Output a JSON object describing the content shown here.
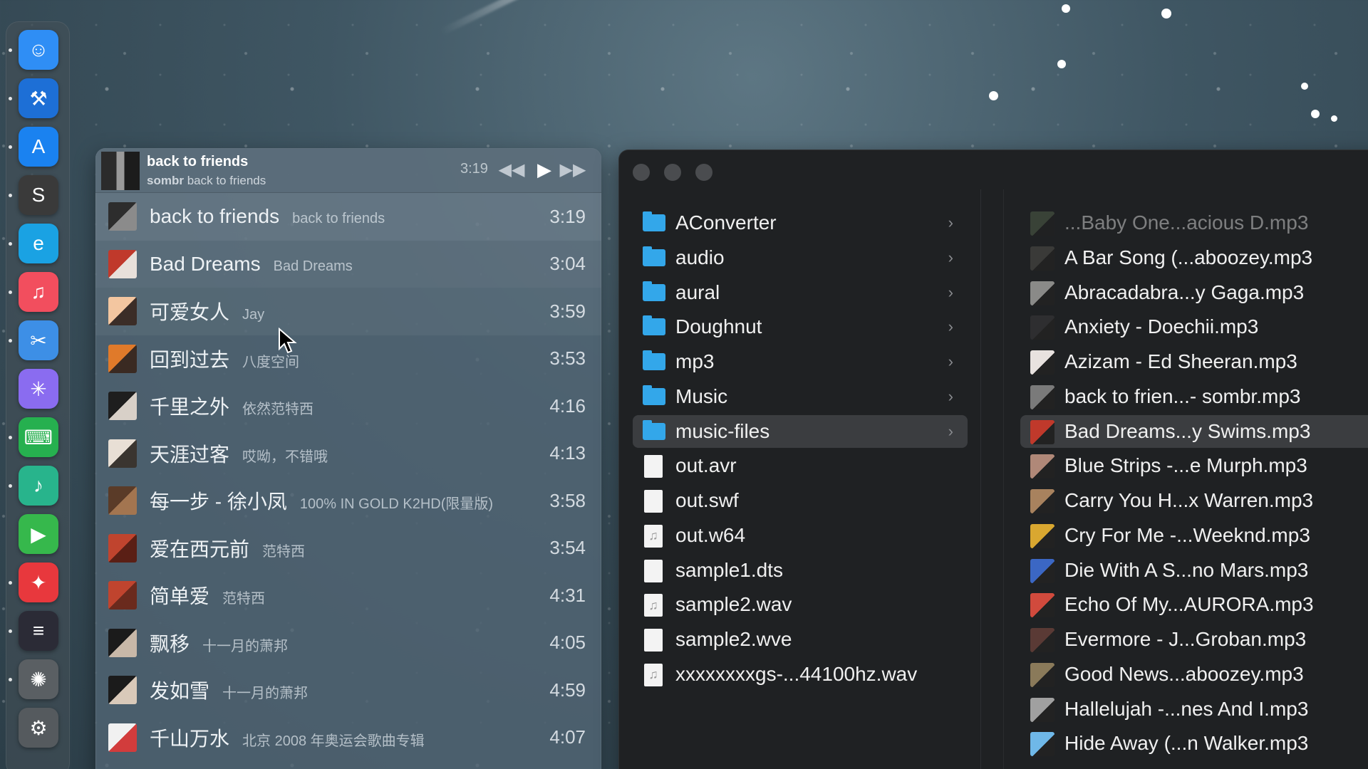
{
  "dock": {
    "items": [
      {
        "name": "finder-icon",
        "glyph": "☺",
        "color": "#2f8ef5",
        "running": true
      },
      {
        "name": "xcode-icon",
        "glyph": "⚒",
        "color": "#1d6fd6",
        "running": true
      },
      {
        "name": "app-store-icon",
        "glyph": "A",
        "color": "#1a82f0",
        "running": true
      },
      {
        "name": "sublime-text-icon",
        "glyph": "S",
        "color": "#3a3a3a",
        "running": true
      },
      {
        "name": "edge-browser-icon",
        "glyph": "e",
        "color": "#1aa2e3",
        "running": true
      },
      {
        "name": "music-app-icon",
        "glyph": "♫",
        "color": "#f24e5e",
        "running": true
      },
      {
        "name": "developer-tools-icon",
        "glyph": "✂",
        "color": "#3d8fe6",
        "running": true
      },
      {
        "name": "launchpad-icon",
        "glyph": "✳",
        "color": "#8a6cf0",
        "running": false
      },
      {
        "name": "keyboard-app-icon",
        "glyph": "⌨",
        "color": "#26b04f",
        "running": true
      },
      {
        "name": "music-note-app-icon",
        "glyph": "♪",
        "color": "#28b48c",
        "running": true
      },
      {
        "name": "infuse-player-icon",
        "glyph": "▶",
        "color": "#36b84c",
        "running": false
      },
      {
        "name": "photo-booth-icon",
        "glyph": "✦",
        "color": "#e8383d",
        "running": true
      },
      {
        "name": "terminal-icon",
        "glyph": "≡",
        "color": "#2b2b36",
        "running": true
      },
      {
        "name": "chatgpt-icon",
        "glyph": "✺",
        "color": "#5a5f63",
        "running": true
      },
      {
        "name": "system-settings-icon",
        "glyph": "⚙",
        "color": "#555a5e",
        "running": false
      }
    ]
  },
  "player": {
    "now_playing": {
      "title": "back to friends",
      "artist": "sombr",
      "album": "back to friends",
      "time": "3:19"
    },
    "tracks": [
      {
        "title": "back to friends",
        "artist": "back to friends",
        "duration": "3:19",
        "art": [
          "#2d2d2d",
          "#8b8b8b"
        ]
      },
      {
        "title": "Bad Dreams",
        "artist": "Bad Dreams",
        "duration": "3:04",
        "art": [
          "#c0392b",
          "#e8e0da"
        ]
      },
      {
        "title": "可爱女人",
        "artist": "Jay",
        "duration": "3:59",
        "art": [
          "#f3c6a0",
          "#3b2d27"
        ]
      },
      {
        "title": "回到过去",
        "artist": "八度空间",
        "duration": "3:53",
        "art": [
          "#e07a2a",
          "#3a2a22"
        ]
      },
      {
        "title": "千里之外",
        "artist": "依然范特西",
        "duration": "4:16",
        "art": [
          "#1e1e1e",
          "#d8d0c8"
        ]
      },
      {
        "title": "天涯过客",
        "artist": "哎呦，不错哦",
        "duration": "4:13",
        "art": [
          "#e8dfd5",
          "#3a3530"
        ]
      },
      {
        "title": "每一步 - 徐小凤",
        "artist": "100% IN GOLD K2HD(限量版)",
        "duration": "3:58",
        "art": [
          "#5a3b28",
          "#a37550"
        ]
      },
      {
        "title": "爱在西元前",
        "artist": "范特西",
        "duration": "3:54",
        "art": [
          "#c0442e",
          "#5a1f15"
        ]
      },
      {
        "title": "简单爱",
        "artist": "范特西",
        "duration": "4:31",
        "art": [
          "#c0442e",
          "#6a2a1d"
        ]
      },
      {
        "title": "飘移",
        "artist": "十一月的萧邦",
        "duration": "4:05",
        "art": [
          "#1b1b1b",
          "#c8b8a8"
        ]
      },
      {
        "title": "发如雪",
        "artist": "十一月的萧邦",
        "duration": "4:59",
        "art": [
          "#1b1b1b",
          "#d9c9b9"
        ]
      },
      {
        "title": "千山万水",
        "artist": "北京 2008 年奥运会歌曲专辑",
        "duration": "4:07",
        "art": [
          "#f1f1f1",
          "#d23c3c"
        ]
      }
    ]
  },
  "finder": {
    "column1": [
      {
        "kind": "folder",
        "name": "AConverter",
        "chevron": "›"
      },
      {
        "kind": "folder",
        "name": "audio",
        "chevron": "›"
      },
      {
        "kind": "folder",
        "name": "aural",
        "chevron": "›"
      },
      {
        "kind": "folder",
        "name": "Doughnut",
        "chevron": "›"
      },
      {
        "kind": "folder",
        "name": "mp3",
        "chevron": "›"
      },
      {
        "kind": "folder",
        "name": "Music",
        "chevron": "›"
      },
      {
        "kind": "folder",
        "name": "music-files",
        "chevron": "›",
        "selected": true
      },
      {
        "kind": "file",
        "name": "out.avr"
      },
      {
        "kind": "file",
        "name": "out.swf"
      },
      {
        "kind": "audio",
        "name": "out.w64"
      },
      {
        "kind": "file",
        "name": "sample1.dts"
      },
      {
        "kind": "audio",
        "name": "sample2.wav"
      },
      {
        "kind": "file",
        "name": "sample2.wve"
      },
      {
        "kind": "audio",
        "name": "xxxxxxxxgs-...44100hz.wav"
      }
    ],
    "column2": [
      {
        "name": "...Baby One...acious D.mp3",
        "art": "#5a6b50",
        "dim": true
      },
      {
        "name": "A Bar Song (...aboozey.mp3",
        "art": "#3a3a38"
      },
      {
        "name": "Abracadabra...y Gaga.mp3",
        "art": "#8a8a88"
      },
      {
        "name": "Anxiety - Doechii.mp3",
        "art": "#2e2e30"
      },
      {
        "name": "Azizam - Ed Sheeran.mp3",
        "art": "#e8e2df"
      },
      {
        "name": "back to frien...- sombr.mp3",
        "art": "#7a7a7a"
      },
      {
        "name": "Bad Dreams...y Swims.mp3",
        "art": "#c0392b",
        "selected": true
      },
      {
        "name": "Blue Strips -...e Murph.mp3",
        "art": "#b08878"
      },
      {
        "name": "Carry You H...x Warren.mp3",
        "art": "#a8825e"
      },
      {
        "name": "Cry For Me -...Weeknd.mp3",
        "art": "#d9a730"
      },
      {
        "name": "Die With A S...no Mars.mp3",
        "art": "#3b67c4"
      },
      {
        "name": "Echo Of My...AURORA.mp3",
        "art": "#d14a3d"
      },
      {
        "name": "Evermore - J...Groban.mp3",
        "art": "#5a3a35"
      },
      {
        "name": "Good News...aboozey.mp3",
        "art": "#8a7a5a"
      },
      {
        "name": "Hallelujah -...nes And I.mp3",
        "art": "#a0a0a0"
      },
      {
        "name": "Hide Away (...n Walker.mp3",
        "art": "#6fb8e8"
      }
    ]
  }
}
